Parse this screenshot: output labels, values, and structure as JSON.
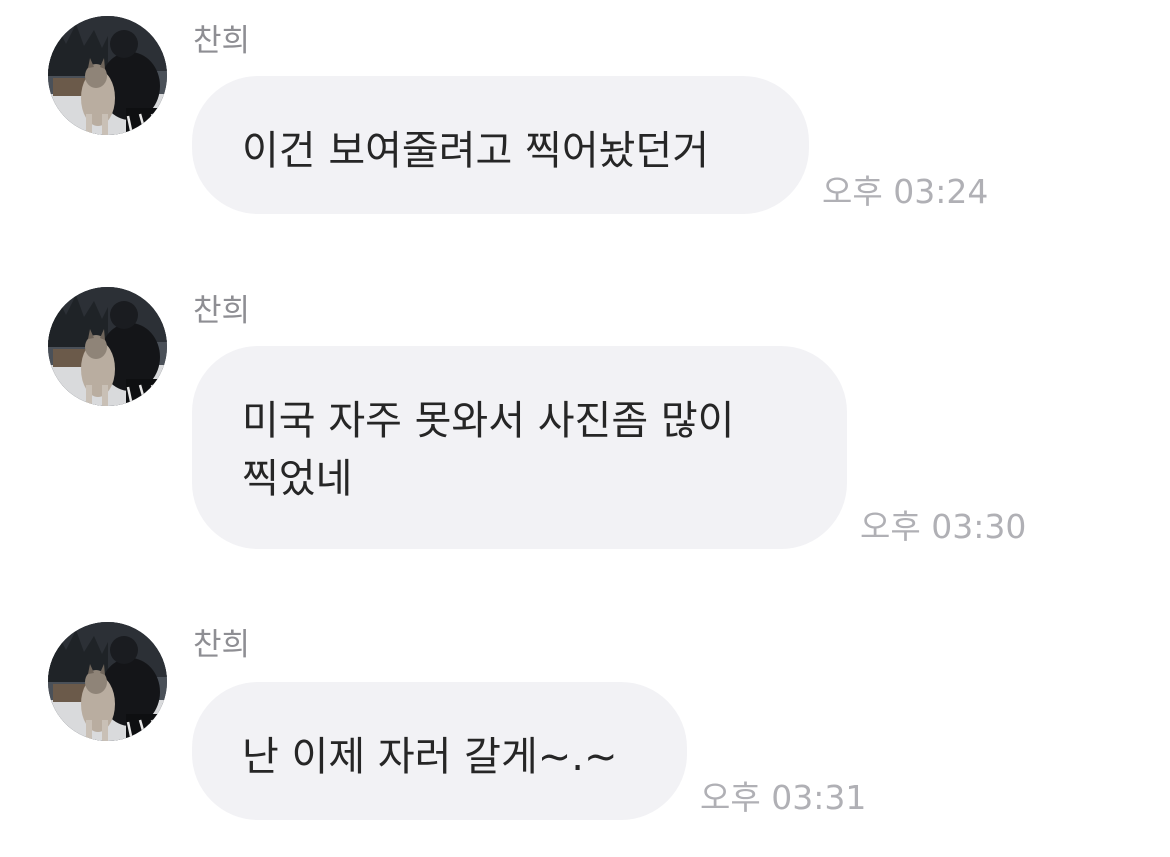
{
  "colors": {
    "background": "#ffffff",
    "bubble": "#f2f2f5",
    "message_text": "#262626",
    "sender_text": "#8e8e93",
    "time_text": "#b0b0b5"
  },
  "messages": [
    {
      "sender": "찬희",
      "avatar_icon": "profile-photo-person-with-dog",
      "lines": [
        "이건 보여줄려고 찍어놨던거"
      ],
      "time": "오후 03:24"
    },
    {
      "sender": "찬희",
      "avatar_icon": "profile-photo-person-with-dog",
      "lines": [
        "미국 자주 못와서 사진좀 많이",
        "찍었네"
      ],
      "time": "오후 03:30"
    },
    {
      "sender": "찬희",
      "avatar_icon": "profile-photo-person-with-dog",
      "lines": [
        "난 이제 자러 갈게~.~"
      ],
      "time": "오후 03:31"
    }
  ]
}
